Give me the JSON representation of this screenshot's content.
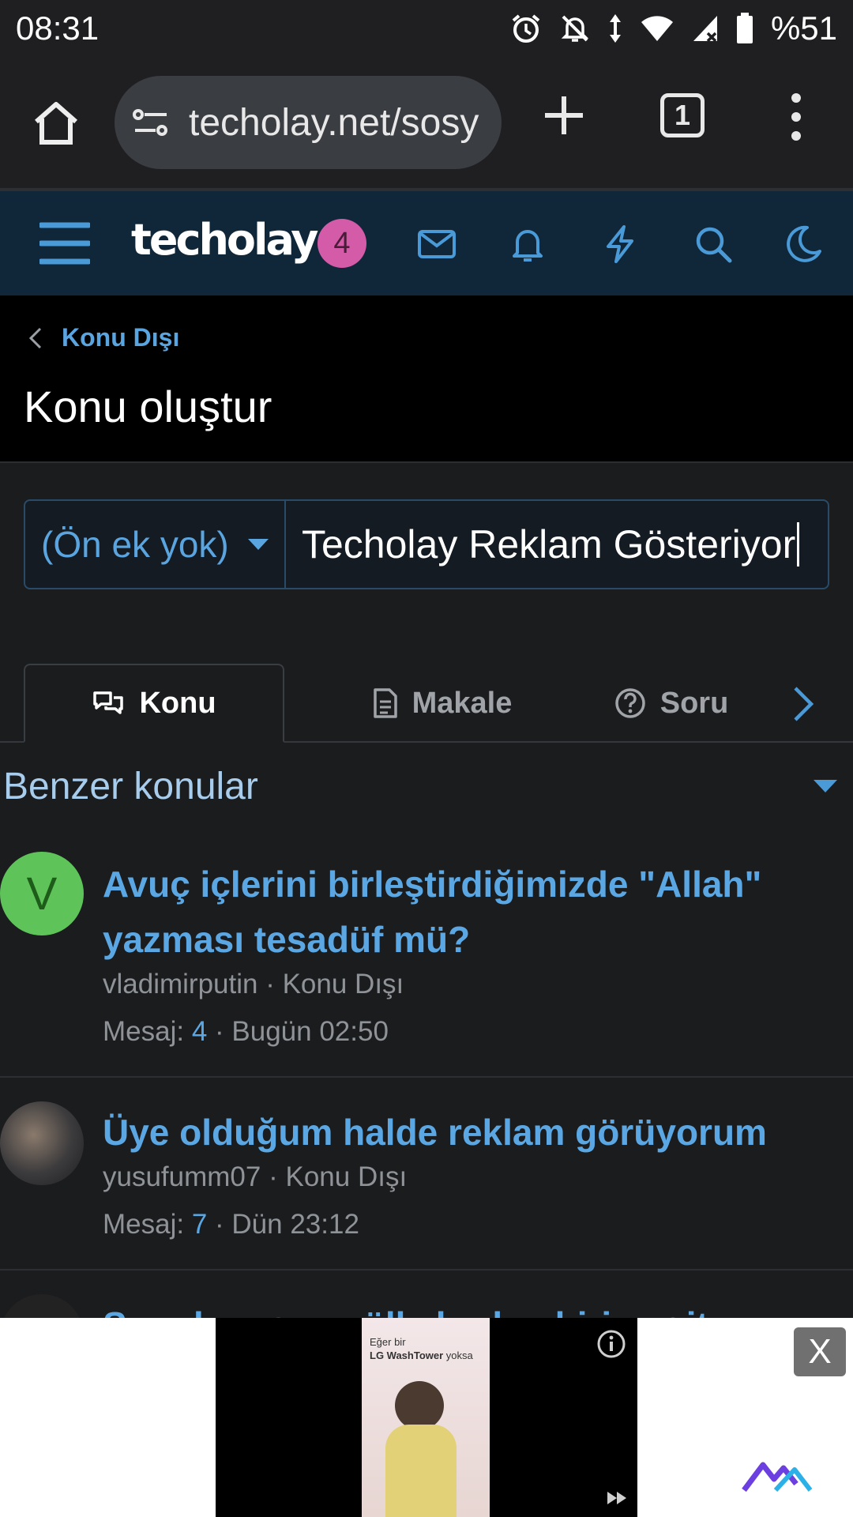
{
  "status_bar": {
    "time": "08:31",
    "battery": "%51",
    "icons": [
      "alarm-icon",
      "bell-off-icon",
      "data-arrows-icon",
      "wifi-icon",
      "signal-icon",
      "battery-icon"
    ]
  },
  "browser": {
    "url": "techolay.net/sosy",
    "tab_count": "1"
  },
  "site_nav": {
    "logo": "techolay",
    "notification_count": "4",
    "icons": [
      "hamburger-icon",
      "mail-icon",
      "bell-icon",
      "bolt-icon",
      "search-icon",
      "moon-icon"
    ]
  },
  "page": {
    "breadcrumb": "Konu Dışı",
    "title": "Konu oluştur"
  },
  "form": {
    "prefix": "(Ön ek yok)",
    "title_value": "Techolay Reklam Gösteriyor"
  },
  "tabs": [
    {
      "label": "Konu",
      "icon": "chat-icon",
      "active": true
    },
    {
      "label": "Makale",
      "icon": "document-icon",
      "active": false
    },
    {
      "label": "Soru",
      "icon": "question-icon",
      "active": false
    }
  ],
  "similar": {
    "title": "Benzer konular",
    "items": [
      {
        "avatar_letter": "V",
        "title": "Avuç içlerini birleştirdiğimizde \"Allah\" yazması tesadüf mü?",
        "author": "vladimirputin",
        "forum": "Konu Dışı",
        "messages_label": "Mesaj:",
        "messages": "4",
        "time": "Bugün 02:50"
      },
      {
        "avatar_letter": "",
        "title": "Üye olduğum halde reklam görüyorum",
        "author": "yusufumm07",
        "forum": "Konu Dışı",
        "messages_label": "Mesaj:",
        "messages": "7",
        "time": "Dün 23:12"
      },
      {
        "title": "Sınır komşusu ülkelerden birine gitme"
      }
    ]
  },
  "ad": {
    "headline_line1": "Eğer bir",
    "headline_brand": "LG WashTower",
    "headline_line2": "yoksa",
    "close_label": "X",
    "colors": {
      "brand_logo": "#6b3fe0"
    }
  }
}
